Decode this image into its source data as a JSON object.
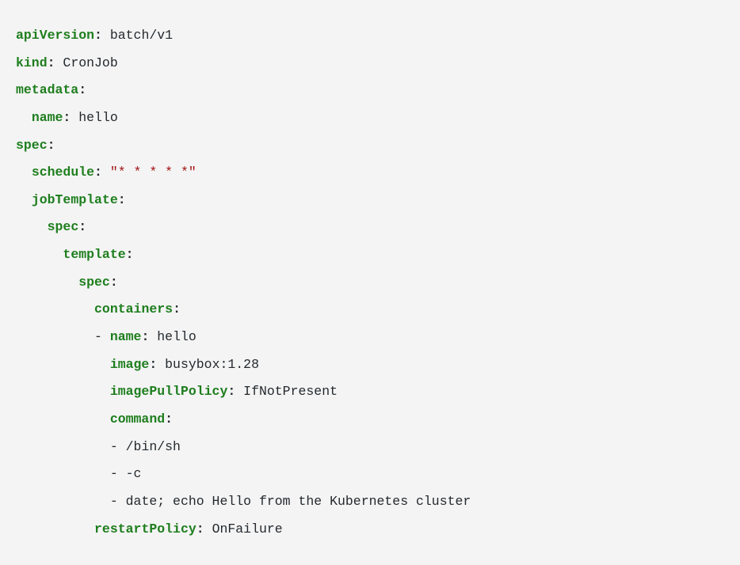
{
  "yaml": {
    "apiVersion_key": "apiVersion",
    "apiVersion_value": "batch/v1",
    "kind_key": "kind",
    "kind_value": "CronJob",
    "metadata_key": "metadata",
    "name_key": "name",
    "name_value": "hello",
    "spec_key": "spec",
    "schedule_key": "schedule",
    "schedule_value": "\"* * * * *\"",
    "jobTemplate_key": "jobTemplate",
    "template_key": "template",
    "containers_key": "containers",
    "container_name_key": "name",
    "container_name_value": "hello",
    "image_key": "image",
    "image_value": "busybox:1.28",
    "imagePullPolicy_key": "imagePullPolicy",
    "imagePullPolicy_value": "IfNotPresent",
    "command_key": "command",
    "command_1": "/bin/sh",
    "command_2": "-c",
    "command_3": "date; echo Hello from the Kubernetes cluster",
    "restartPolicy_key": "restartPolicy",
    "restartPolicy_value": "OnFailure"
  }
}
